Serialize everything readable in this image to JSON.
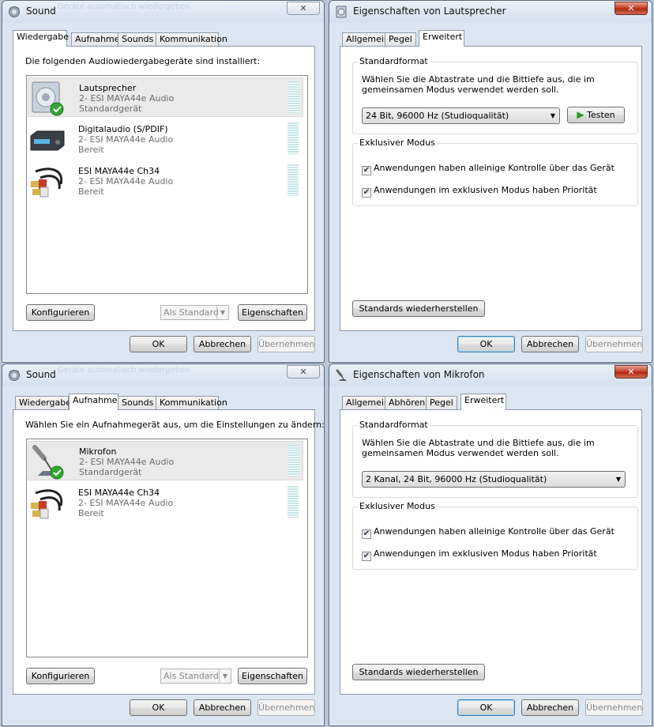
{
  "sound_play": {
    "title": "Sound",
    "ghost_text": "Geräte automatisch wiedergeben",
    "close": "✕",
    "tabs": [
      "Wiedergabe",
      "Aufnahme",
      "Sounds",
      "Kommunikation"
    ],
    "active_tab": "Wiedergabe",
    "instruction": "Die folgenden Audiowiedergabegeräte sind installiert:",
    "devices": [
      {
        "name": "Lautsprecher",
        "driver": "2- ESI MAYA44e Audio",
        "status": "Standardgerät",
        "icon": "speaker-icon",
        "selected": true
      },
      {
        "name": "Digitalaudio (S/PDIF)",
        "driver": "2- ESI MAYA44e Audio",
        "status": "Bereit",
        "icon": "digital-audio-icon",
        "selected": false
      },
      {
        "name": "ESI MAYA44e Ch34",
        "driver": "2- ESI MAYA44e Audio",
        "status": "Bereit",
        "icon": "rca-cable-icon",
        "selected": false
      }
    ],
    "configure": "Konfigurieren",
    "set_default": "Als Standard",
    "properties": "Eigenschaften",
    "ok": "OK",
    "cancel": "Abbrechen",
    "apply": "Übernehmen"
  },
  "speaker_props": {
    "title": "Eigenschaften von Lautsprecher",
    "close": "✕",
    "tabs": [
      "Allgemein",
      "Pegel",
      "Erweitert"
    ],
    "active_tab": "Erweitert",
    "default_format_label": "Standardformat",
    "default_format_desc": "Wählen Sie die Abtastrate und die Bittiefe aus, die im gemeinsamen Modus verwendet werden soll.",
    "format_value": "24 Bit, 96000 Hz (Studioqualität)",
    "test": "Testen",
    "exclusive_label": "Exklusiver Modus",
    "exclusive_1": "Anwendungen haben alleinige Kontrolle über das Gerät",
    "exclusive_2": "Anwendungen im exklusiven Modus haben Priorität",
    "exclusive_1_checked": true,
    "exclusive_2_checked": true,
    "restore": "Standards wiederherstellen",
    "ok": "OK",
    "cancel": "Abbrechen",
    "apply": "Übernehmen"
  },
  "sound_rec": {
    "title": "Sound",
    "ghost_text": "Geräte automatisch wiedergeben",
    "close": "✕",
    "tabs": [
      "Wiedergabe",
      "Aufnahme",
      "Sounds",
      "Kommunikation"
    ],
    "active_tab": "Aufnahme",
    "instruction": "Wählen Sie ein Aufnahmegerät aus, um die Einstellungen zu ändern:",
    "devices": [
      {
        "name": "Mikrofon",
        "driver": "2- ESI MAYA44e Audio",
        "status": "Standardgerät",
        "icon": "microphone-icon",
        "selected": true
      },
      {
        "name": "ESI MAYA44e Ch34",
        "driver": "2- ESI MAYA44e Audio",
        "status": "Bereit",
        "icon": "rca-cable-icon",
        "selected": false
      }
    ],
    "configure": "Konfigurieren",
    "set_default": "Als Standard",
    "properties": "Eigenschaften",
    "ok": "OK",
    "cancel": "Abbrechen",
    "apply": "Übernehmen"
  },
  "mic_props": {
    "title": "Eigenschaften von Mikrofon",
    "close": "✕",
    "tabs": [
      "Allgemein",
      "Abhören",
      "Pegel",
      "Erweitert"
    ],
    "active_tab": "Erweitert",
    "default_format_label": "Standardformat",
    "default_format_desc": "Wählen Sie die Abtastrate und die Bittiefe aus, die im gemeinsamen Modus verwendet werden soll.",
    "format_value": "2 Kanal, 24 Bit, 96000 Hz (Studioqualität)",
    "exclusive_label": "Exklusiver Modus",
    "exclusive_1": "Anwendungen haben alleinige Kontrolle über das Gerät",
    "exclusive_2": "Anwendungen im exklusiven Modus haben Priorität",
    "exclusive_1_checked": true,
    "exclusive_2_checked": true,
    "restore": "Standards wiederherstellen",
    "ok": "OK",
    "cancel": "Abbrechen",
    "apply": "Übernehmen"
  },
  "colors": {
    "window_bg": "#dce6f2",
    "close_red": "#c9452d",
    "default_btn_border": "#3c7fb1",
    "check_green": "#2f9a2f"
  }
}
